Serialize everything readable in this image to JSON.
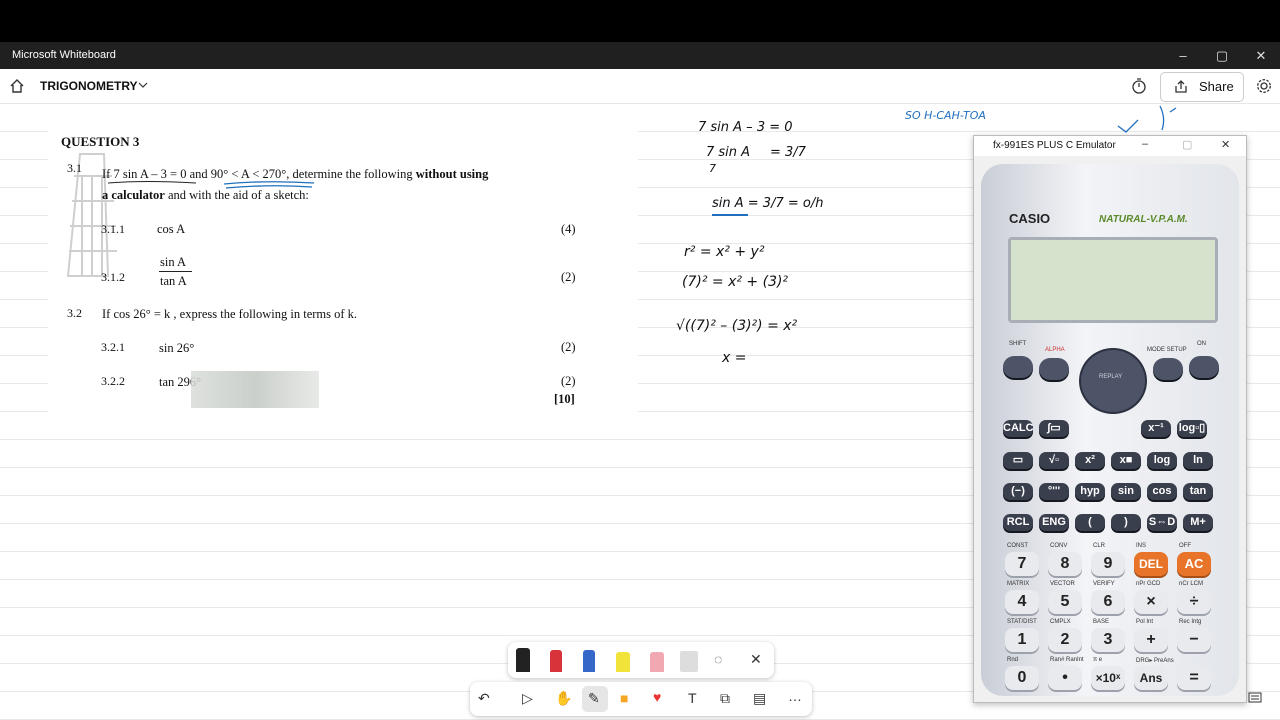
{
  "window": {
    "app_title": "Microsoft Whiteboard"
  },
  "toolbar": {
    "board_name": "TRIGONOMETRY",
    "share_label": "Share"
  },
  "question": {
    "heading": "QUESTION 3",
    "q31_num": "3.1",
    "q31_text_a": "If 7 sin A – 3 = 0 and  90° < A < 270°, determine the following ",
    "q31_bold1": "without using",
    "q31_text_b_bold": "a calculator",
    "q31_text_c": " and with the aid of a sketch:",
    "q311_num": "3.1.1",
    "q311_text": "cos A",
    "q311_marks": "(4)",
    "q312_num": "3.1.2",
    "q312_top": "sin A",
    "q312_bot": "tan A",
    "q312_marks": "(2)",
    "q32_num": "3.2",
    "q32_text": "If cos 26° = k , express the following in terms of k.",
    "q321_num": "3.2.1",
    "q321_text": "sin 26°",
    "q321_marks": "(2)",
    "q322_num": "3.2.2",
    "q322_text": "tan 296°",
    "q322_marks": "(2)",
    "total": "[10]"
  },
  "handwriting": {
    "l1": "7 sin A – 3 = 0",
    "l2a": "7 sin A",
    "l2b": "7",
    "l2c": "= 3/7",
    "l3": "sin A = 3/7 = o/h",
    "l4": "r² = x² + y²",
    "l5": "(7)² = x² + (3)²",
    "l6": "√((7)² – (3)²) = x²",
    "l7": "x =",
    "soh": "SO H-CAH-TOA"
  },
  "calculator": {
    "window_title": "fx-991ES PLUS C Emulator",
    "brand": "CASIO",
    "model": "NATURAL-V.P.A.M.",
    "row_fn": {
      "shift": "SHIFT",
      "alpha": "ALPHA",
      "mode": "MODE SETUP",
      "on": "ON",
      "replay": "REPLAY"
    },
    "keys_r1": [
      "CALC",
      "∫▭",
      "x⁻¹",
      "log▫▯"
    ],
    "keys_r2": [
      "▭",
      "√▫",
      "x²",
      "x■",
      "log",
      "ln"
    ],
    "keys_r3": [
      "(−)",
      "°'''",
      "hyp",
      "sin",
      "cos",
      "tan"
    ],
    "keys_r4": [
      "RCL",
      "ENG",
      "(",
      ")",
      "S⇔D",
      "M+"
    ],
    "keys_r5": [
      "7",
      "8",
      "9",
      "DEL",
      "AC"
    ],
    "keys_r6": [
      "4",
      "5",
      "6",
      "×",
      "÷"
    ],
    "keys_r7": [
      "1",
      "2",
      "3",
      "+",
      "−"
    ],
    "keys_r8": [
      "0",
      "•",
      "×10ˣ",
      "Ans",
      "="
    ],
    "lbls_r5": [
      "CONST",
      "CONV",
      "CLR",
      "INS",
      "OFF"
    ],
    "lbls_r6": [
      "MATRIX",
      "VECTOR",
      "VERIFY",
      "nPr GCD",
      "nCr LCM"
    ],
    "lbls_r7": [
      "STAT/DIST",
      "CMPLX",
      "BASE",
      "Pol Int",
      "Rec Intg"
    ],
    "lbls_r8": [
      "Rnd",
      "Ran# RanInt",
      "π  e",
      "DRG▸ PreAns",
      ""
    ]
  },
  "accent": {
    "orange": "#e8742a",
    "pen_blue": "#1f6fbf"
  }
}
